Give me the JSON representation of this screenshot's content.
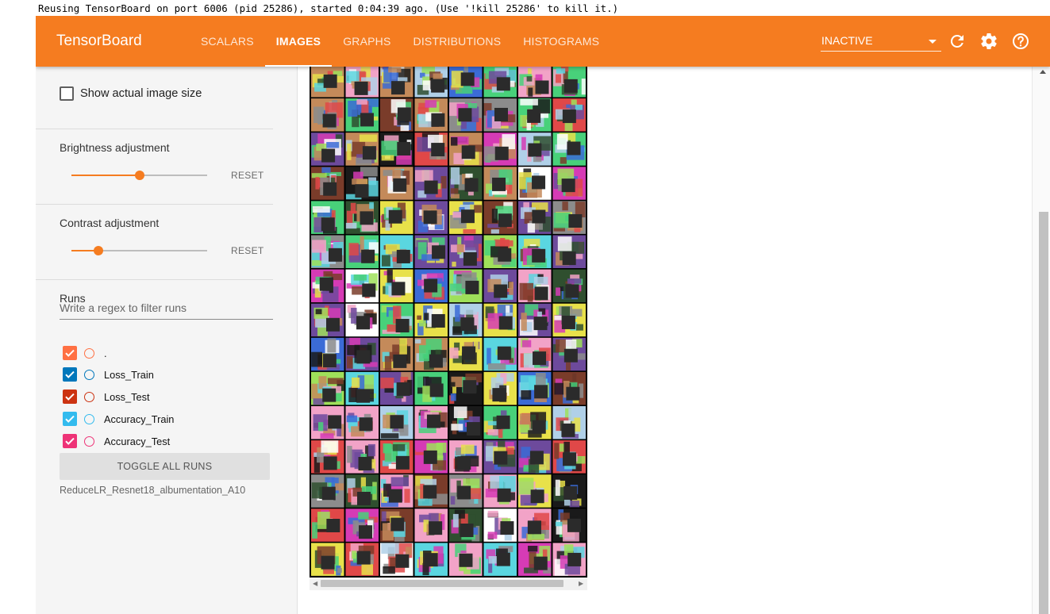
{
  "console": {
    "message": "Reusing TensorBoard on port 6006 (pid 25286), started 0:04:39 ago. (Use '!kill 25286' to kill it.)"
  },
  "toolbar": {
    "brand": "TensorBoard",
    "tabs": [
      {
        "label": "SCALARS",
        "active": false
      },
      {
        "label": "IMAGES",
        "active": true
      },
      {
        "label": "GRAPHS",
        "active": false
      },
      {
        "label": "DISTRIBUTIONS",
        "active": false
      },
      {
        "label": "HISTOGRAMS",
        "active": false
      }
    ],
    "status_select": "INACTIVE",
    "icons": [
      "refresh-icon",
      "settings-gear-icon",
      "help-icon"
    ]
  },
  "sidebar": {
    "show_actual_size_label": "Show actual image size",
    "show_actual_size_checked": false,
    "brightness": {
      "label": "Brightness adjustment",
      "level": 0.5,
      "reset_label": "RESET"
    },
    "contrast": {
      "label": "Contrast adjustment",
      "level": 0.2,
      "reset_label": "RESET"
    },
    "runs": {
      "title": "Runs",
      "filter_placeholder": "Write a regex to filter runs",
      "items": [
        {
          "name": ".",
          "color": "#ff7043",
          "checked": true
        },
        {
          "name": "Loss_Train",
          "color": "#0077bb",
          "checked": true
        },
        {
          "name": "Loss_Test",
          "color": "#cc3311",
          "checked": true
        },
        {
          "name": "Accuracy_Train",
          "color": "#33bbee",
          "checked": true
        },
        {
          "name": "Accuracy_Test",
          "color": "#ee3377",
          "checked": true
        }
      ],
      "toggle_label": "TOGGLE ALL RUNS",
      "footer": "ReduceLR_Resnet18_albumentation_A10"
    }
  },
  "image_panel": {
    "rows": 15,
    "cols": 8,
    "accent": "#f57c20"
  }
}
